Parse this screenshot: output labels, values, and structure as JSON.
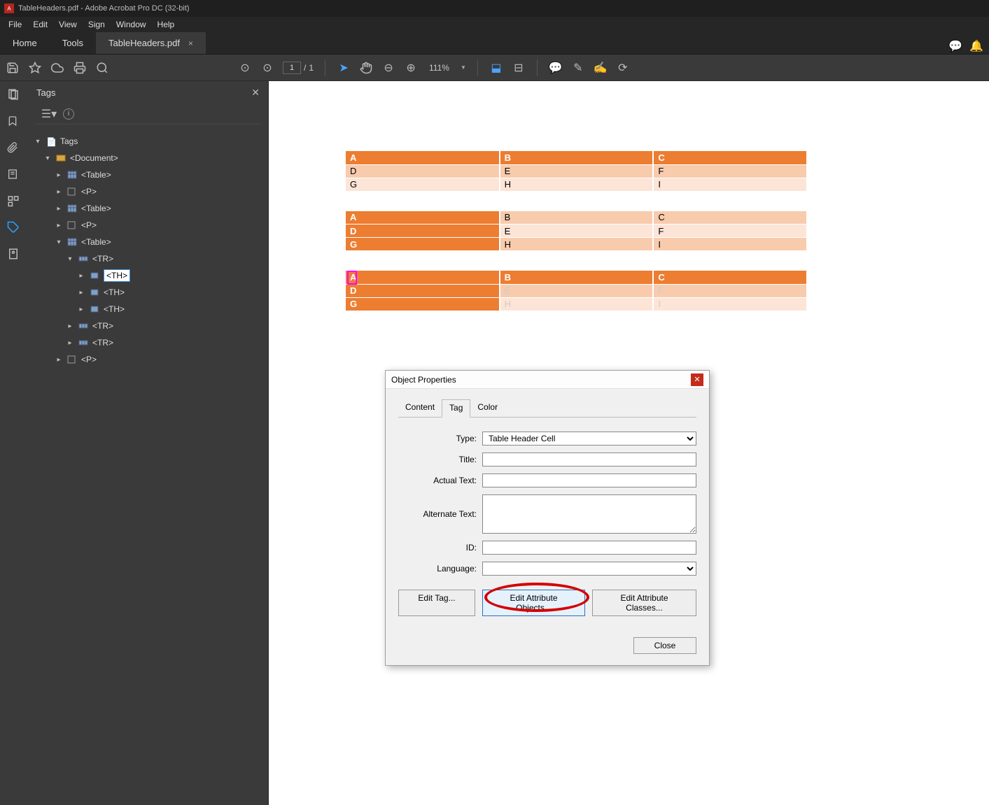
{
  "window": {
    "title": "TableHeaders.pdf - Adobe Acrobat Pro DC (32-bit)"
  },
  "menu": {
    "file": "File",
    "edit": "Edit",
    "view": "View",
    "sign": "Sign",
    "window": "Window",
    "help": "Help"
  },
  "apptabs": {
    "home": "Home",
    "tools": "Tools",
    "doc": "TableHeaders.pdf"
  },
  "toolbar": {
    "page_current": "1",
    "page_sep": "/",
    "page_total": "1",
    "zoom": "111%"
  },
  "panel": {
    "title": "Tags",
    "tree": {
      "root": "Tags",
      "items": [
        {
          "label": "<Document>",
          "depth": 1,
          "twisty": "open",
          "icon": "container"
        },
        {
          "label": "<Table>",
          "depth": 2,
          "twisty": "closed",
          "icon": "table"
        },
        {
          "label": "<P>",
          "depth": 2,
          "twisty": "closed",
          "icon": "p"
        },
        {
          "label": "<Table>",
          "depth": 2,
          "twisty": "closed",
          "icon": "table"
        },
        {
          "label": "<P>",
          "depth": 2,
          "twisty": "closed",
          "icon": "p"
        },
        {
          "label": "<Table>",
          "depth": 2,
          "twisty": "open",
          "icon": "table"
        },
        {
          "label": "<TR>",
          "depth": 3,
          "twisty": "open",
          "icon": "row"
        },
        {
          "label": "<TH>",
          "depth": 4,
          "twisty": "closed",
          "icon": "cell",
          "selected": true
        },
        {
          "label": "<TH>",
          "depth": 4,
          "twisty": "closed",
          "icon": "cell"
        },
        {
          "label": "<TH>",
          "depth": 4,
          "twisty": "closed",
          "icon": "cell"
        },
        {
          "label": "<TR>",
          "depth": 3,
          "twisty": "closed",
          "icon": "row"
        },
        {
          "label": "<TR>",
          "depth": 3,
          "twisty": "closed",
          "icon": "row"
        },
        {
          "label": "<P>",
          "depth": 2,
          "twisty": "closed",
          "icon": "p"
        }
      ]
    }
  },
  "doc": {
    "t1": {
      "r1": [
        "A",
        "B",
        "C"
      ],
      "r2": [
        "D",
        "E",
        "F"
      ],
      "r3": [
        "G",
        "H",
        "I"
      ]
    },
    "t2": {
      "r1": [
        "A",
        "B",
        "C"
      ],
      "r2": [
        "D",
        "E",
        "F"
      ],
      "r3": [
        "G",
        "H",
        "I"
      ]
    },
    "t3": {
      "r1": [
        "A",
        "B",
        "C"
      ],
      "r2": [
        "D",
        "E",
        "F"
      ],
      "r3": [
        "G",
        "H",
        "I"
      ]
    }
  },
  "dialog": {
    "title": "Object Properties",
    "tabs": {
      "content": "Content",
      "tag": "Tag",
      "color": "Color"
    },
    "labels": {
      "type": "Type:",
      "title": "Title:",
      "actual": "Actual Text:",
      "alternate": "Alternate Text:",
      "id": "ID:",
      "language": "Language:"
    },
    "values": {
      "type": "Table Header Cell",
      "title": "",
      "actual": "",
      "alternate": "",
      "id": "",
      "language": ""
    },
    "buttons": {
      "edit_tag": "Edit Tag...",
      "edit_attr_obj": "Edit Attribute Objects...",
      "edit_attr_cls": "Edit Attribute Classes...",
      "close": "Close"
    }
  }
}
